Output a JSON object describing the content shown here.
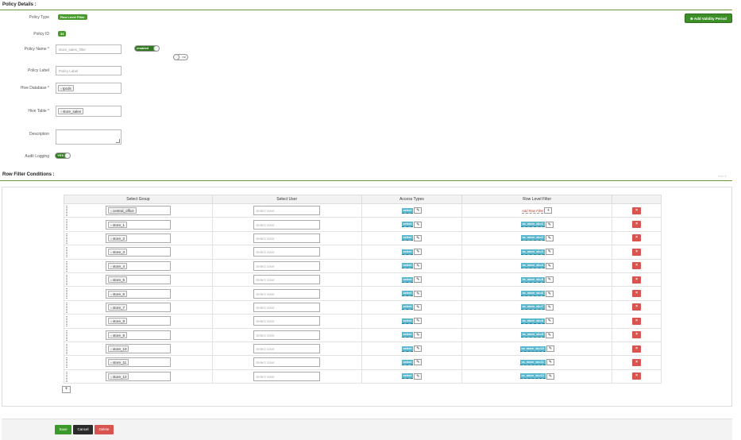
{
  "policy_details": {
    "title": "Policy Details :",
    "policy_type_label": "Policy Type",
    "policy_type_value": "Row Level Filter",
    "policy_id_label": "Policy ID",
    "policy_id_value": "33",
    "policy_name_label": "Policy Name *",
    "policy_name_value": "store_sales_filter",
    "enabled_toggle": "enabled",
    "override_toggle": "no",
    "policy_label_label": "Policy Label",
    "policy_label_placeholder": "Policy Label",
    "hive_database_label": "Hive Database *",
    "hive_database_value": "tpcds",
    "hive_table_label": "Hive Table *",
    "hive_table_value": "store_sales",
    "description_label": "Description",
    "audit_logging_label": "Audit Logging",
    "audit_logging_value": "YES",
    "add_validity_button": "Add Validity Period"
  },
  "row_filter": {
    "title": "Row Filter Conditions :",
    "hide_link": "hide ▾",
    "columns": [
      "Select Group",
      "Select User",
      "Access Types",
      "Row Level Filter",
      ""
    ],
    "user_placeholder": "Select User",
    "access_tag": "select",
    "add_filter_text": "Add Row Filter",
    "rows": [
      {
        "group": "central_office",
        "filter": ""
      },
      {
        "group": "store_1",
        "filter": "ss_store_sk=1"
      },
      {
        "group": "store_2",
        "filter": "ss_store_sk=2"
      },
      {
        "group": "store_3",
        "filter": "ss_store_sk=3"
      },
      {
        "group": "store_4",
        "filter": "ss_store_sk=4"
      },
      {
        "group": "store_5",
        "filter": "ss_store_sk=5"
      },
      {
        "group": "store_6",
        "filter": "ss_store_sk=6"
      },
      {
        "group": "store_7",
        "filter": "ss_store_sk=7"
      },
      {
        "group": "store_8",
        "filter": "ss_store_sk=8"
      },
      {
        "group": "store_9",
        "filter": "ss_store_sk=9"
      },
      {
        "group": "store_10",
        "filter": "ss_store_sk=10"
      },
      {
        "group": "store_11",
        "filter": "ss_store_sk=11"
      },
      {
        "group": "store_12",
        "filter": "ss_store_sk=12"
      }
    ]
  },
  "footer": {
    "save": "Save",
    "cancel": "Cancel",
    "delete": "Delete"
  },
  "colors": {
    "accent_green": "#3c8e27",
    "filter_cyan": "#5bb8cf",
    "delete_red": "#d9534f"
  }
}
